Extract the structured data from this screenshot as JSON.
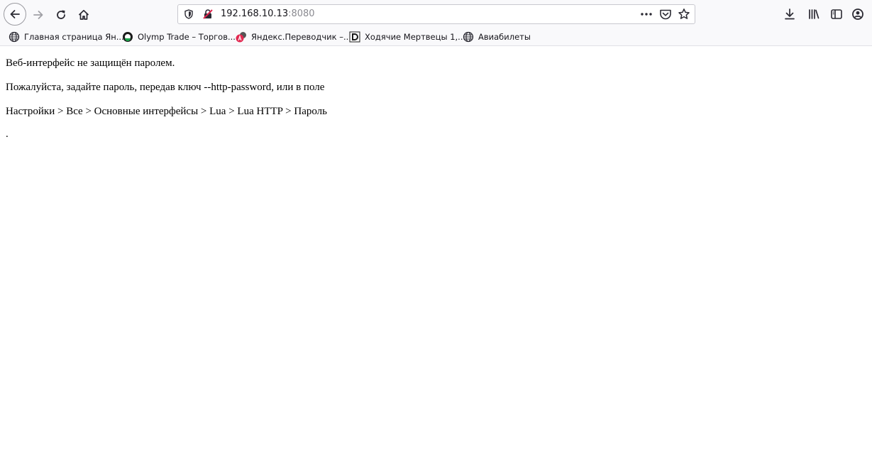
{
  "url": {
    "host": "192.168.10.13",
    "port": ":8080"
  },
  "bookmarks": [
    {
      "label": "Главная страница Ян...",
      "icon": "globe-icon"
    },
    {
      "label": "Olymp Trade – Торгов...",
      "icon": "olymp-logo-icon"
    },
    {
      "label": "Яндекс.Переводчик –...",
      "icon": "yandex-translate-icon"
    },
    {
      "label": "Ходячие Мертвецы 1,...",
      "icon": "d-logo-icon"
    },
    {
      "label": "Авиабилеты",
      "icon": "globe-icon"
    }
  ],
  "page": {
    "line1": "Веб-интерфейс не защищён паролем.",
    "line2": "Пожалуйста, задайте пароль, передав ключ --http-password, или в поле",
    "line3": "Настройки > Все > Основные интерфейсы > Lua > Lua HTTP > Пароль",
    "line4": "."
  },
  "colors": {
    "chrome_bg": "#f9f9fb",
    "text": "#000000",
    "insecure_red": "#e22850"
  }
}
